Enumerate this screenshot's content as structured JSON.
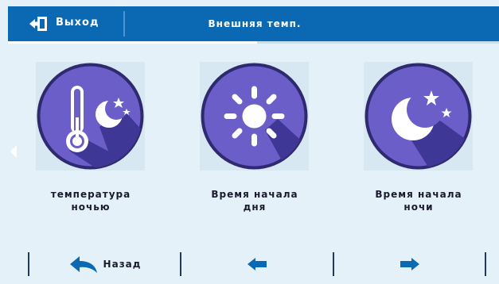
{
  "header": {
    "exit_label": "Выход",
    "title": "Внешняя темп."
  },
  "tiles": [
    {
      "label_line1": "температура",
      "label_line2": "ночью",
      "icon": "thermometer-moon-icon"
    },
    {
      "label_line1": "Время начала",
      "label_line2": "дня",
      "icon": "sun-icon"
    },
    {
      "label_line1": "Время начала",
      "label_line2": "ночи",
      "icon": "moon-stars-icon"
    }
  ],
  "footer": {
    "back_label": "Назад"
  },
  "colors": {
    "header_bg": "#0b69b3",
    "circle_fill": "#6b5ec9",
    "circle_ring": "#2f2a70",
    "shadow": "#3f3796",
    "background": "#e4f1f9"
  }
}
